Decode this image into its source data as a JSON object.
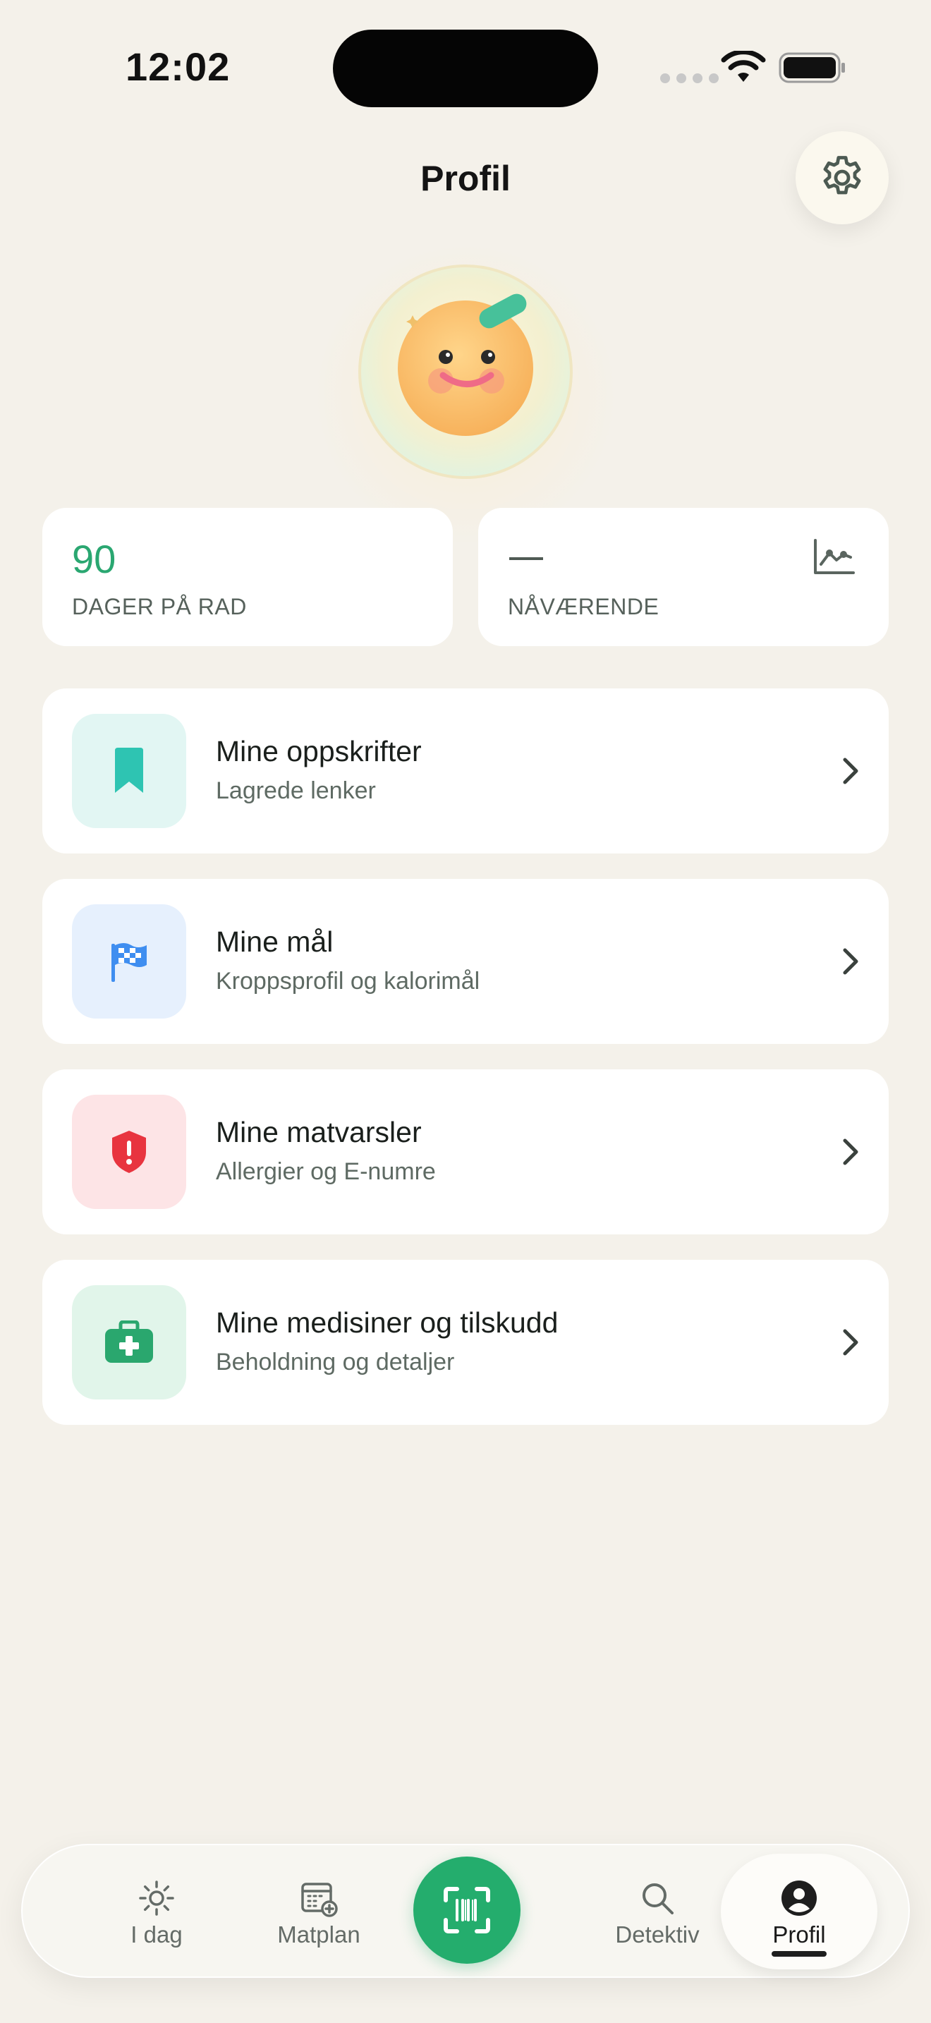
{
  "status_bar": {
    "time": "12:02"
  },
  "header": {
    "title": "Profil"
  },
  "stats": [
    {
      "value": "90",
      "label": "DAGER PÅ RAD"
    },
    {
      "value": "—",
      "label": "NÅVÆRENDE"
    }
  ],
  "menu": [
    {
      "title": "Mine oppskrifter",
      "subtitle": "Lagrede lenker",
      "icon": "bookmark-icon",
      "icon_bg": "#e2f6f3",
      "icon_color": "#2ec4b2"
    },
    {
      "title": "Mine mål",
      "subtitle": "Kroppsprofil og kalorimål",
      "icon": "checkered-flag-icon",
      "icon_bg": "#e6f0fd",
      "icon_color": "#3f8ef0"
    },
    {
      "title": "Mine matvarsler",
      "subtitle": "Allergier og E-numre",
      "icon": "shield-alert-icon",
      "icon_bg": "#fde4e6",
      "icon_color": "#e8343f"
    },
    {
      "title": "Mine medisiner og tilskudd",
      "subtitle": "Beholdning og detaljer",
      "icon": "first-aid-kit-icon",
      "icon_bg": "#e1f5ea",
      "icon_color": "#2aa76e"
    }
  ],
  "tabbar": {
    "items": [
      {
        "label": "I dag",
        "icon": "sun-icon"
      },
      {
        "label": "Matplan",
        "icon": "calendar-add-icon"
      },
      {
        "label": "Detektiv",
        "icon": "search-icon"
      },
      {
        "label": "Profil",
        "icon": "person-icon",
        "active": true
      }
    ],
    "center_icon": "barcode-scan-icon"
  },
  "colors": {
    "accent": "#24ad6d",
    "background": "#f4f1ea",
    "stat_value": "#2aa771"
  }
}
